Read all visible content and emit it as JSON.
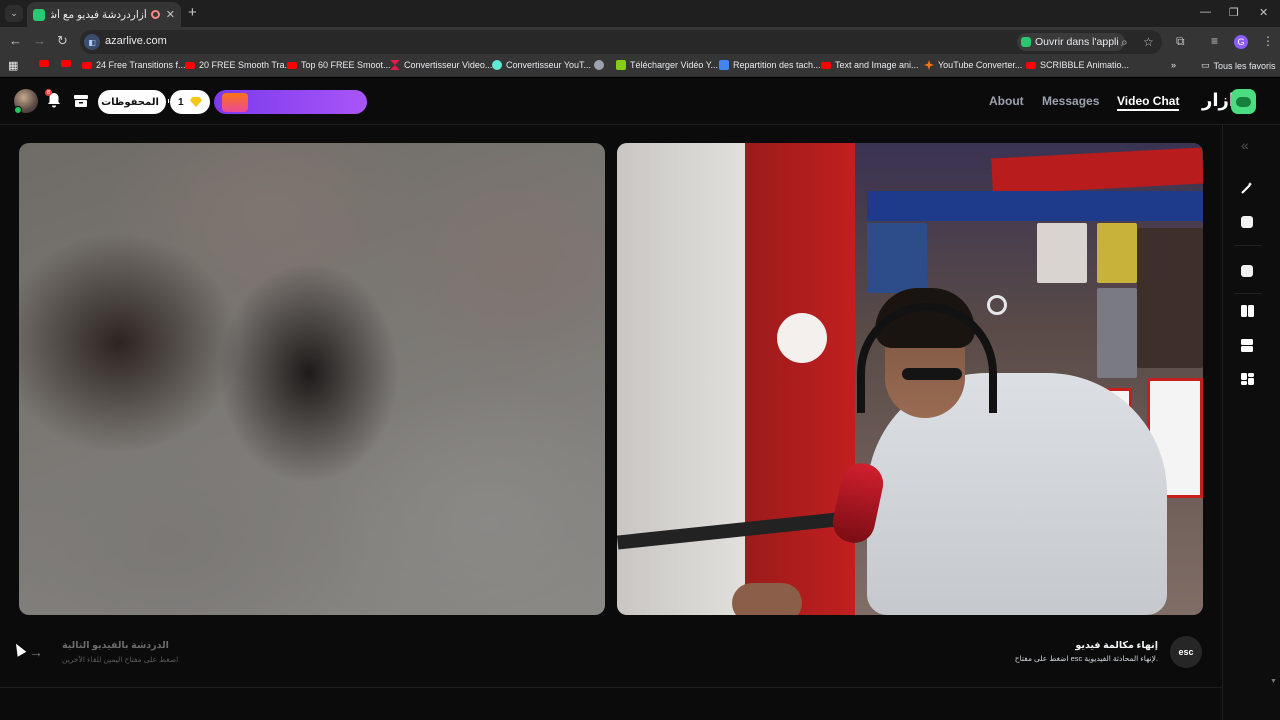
{
  "browser": {
    "tab_title": "أزاردردشة فيديو مع أشخاص",
    "new_tab": "+",
    "close": "✕",
    "url": "azarlive.com",
    "open_app": "Ouvrir dans l'appli",
    "all_bookmarks": "Tous les favoris",
    "bookmarks": [
      {
        "label": "",
        "icon": "youtube-icon"
      },
      {
        "label": "",
        "icon": "youtube-icon"
      },
      {
        "label": "24 Free Transitions f...",
        "icon": "youtube-icon"
      },
      {
        "label": "20 FREE Smooth Tra...",
        "icon": "youtube-icon"
      },
      {
        "label": "Top 60 FREE Smoot...",
        "icon": "youtube-icon"
      },
      {
        "label": "Convertisseur Video...",
        "icon": "z-icon"
      },
      {
        "label": "Convertisseur YouT...",
        "icon": "convert-icon"
      },
      {
        "label": "",
        "icon": "globe-icon"
      },
      {
        "label": "Télécharger Vidéo Y...",
        "icon": "download-icon"
      },
      {
        "label": "Repartition des tach...",
        "icon": "docs-icon"
      },
      {
        "label": "Text and Image ani...",
        "icon": "youtube-icon"
      },
      {
        "label": "YouTube Converter...",
        "icon": "star-icon"
      },
      {
        "label": "SCRIBBLE Animatio...",
        "icon": "youtube-icon"
      }
    ],
    "profile_initial": "G"
  },
  "header": {
    "notification_count": "8",
    "saved_label": "المحفوظات",
    "gems_count": "1",
    "nav": [
      {
        "label": "About",
        "active": false
      },
      {
        "label": "Messages",
        "active": false
      },
      {
        "label": "Video Chat",
        "active": true
      }
    ],
    "brand": "ازار"
  },
  "controls": {
    "next_title": "الدردشة بالفيديو التالية",
    "next_subtitle": "اضغط على مفتاح اليمين للقاء الآخرين",
    "end_title": "إنهاء مكالمة فيديو",
    "end_subtitle": "اضغط على مفتاح esc لإنهاء المحادثة الفيديوية.",
    "esc_key": "esc"
  },
  "side_toolbar": [
    "collapse-icon",
    "magic-wand-icon",
    "face-filter-icon",
    "dice-icon",
    "layout-side-by-side-icon",
    "layout-stacked-icon",
    "layout-grid-icon"
  ],
  "colors": {
    "brand": "#4ade80",
    "promo": "#8b5cf6",
    "tab_favicon": "#29c971"
  }
}
